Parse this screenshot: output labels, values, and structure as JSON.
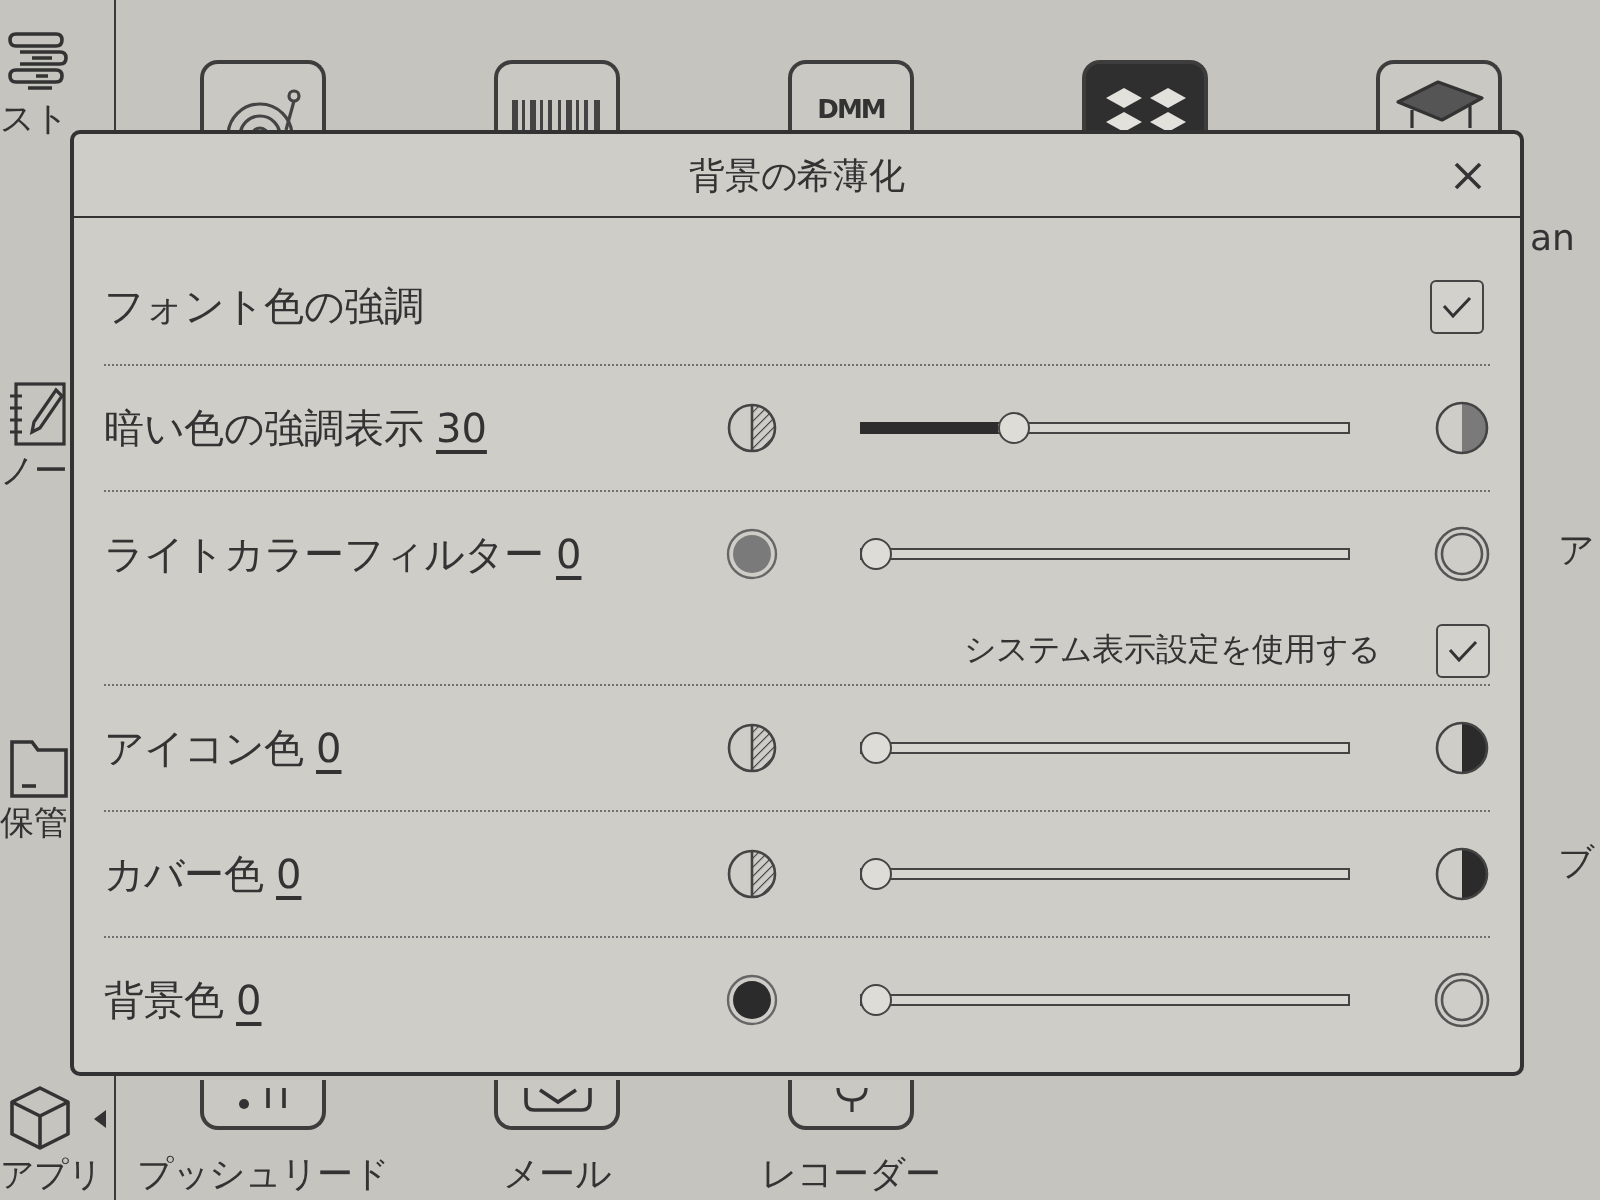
{
  "sidebar": [
    {
      "kind": "store",
      "label": "スト"
    },
    {
      "kind": "notebook",
      "label": "ノー"
    },
    {
      "kind": "folder",
      "label": "保管"
    },
    {
      "kind": "apps",
      "label": "アプリ"
    }
  ],
  "top_apps": [
    {
      "kind": "record"
    },
    {
      "kind": "barcode"
    },
    {
      "kind": "logo",
      "label": "DMM"
    },
    {
      "kind": "diamonds"
    },
    {
      "kind": "cap"
    }
  ],
  "right_edge": [
    "an",
    "ア",
    "ブ"
  ],
  "bottom_apps": [
    {
      "kind": "dots",
      "label": "プッシュリード"
    },
    {
      "kind": "mail",
      "label": "メール"
    },
    {
      "kind": "mic",
      "label": "レコーダー"
    }
  ],
  "dialog": {
    "title": "背景の希薄化",
    "rows": [
      {
        "kind": "checkbox",
        "label": "フォント色の強調",
        "checked": true
      },
      {
        "kind": "shade",
        "label": "暗い色の強調表示",
        "value": "30",
        "level": 0.3
      },
      {
        "kind": "fill",
        "label": "ライトカラーフィルター",
        "value": "0",
        "level": 0,
        "option": {
          "label": "システム表示設定を使用する",
          "checked": true
        }
      },
      {
        "kind": "shade",
        "label": "アイコン色",
        "value": "0",
        "level": 0
      },
      {
        "kind": "shade",
        "label": "カバー色",
        "value": "0",
        "level": 0
      },
      {
        "kind": "fill",
        "label": "背景色",
        "value": "0",
        "level": 0
      }
    ]
  }
}
